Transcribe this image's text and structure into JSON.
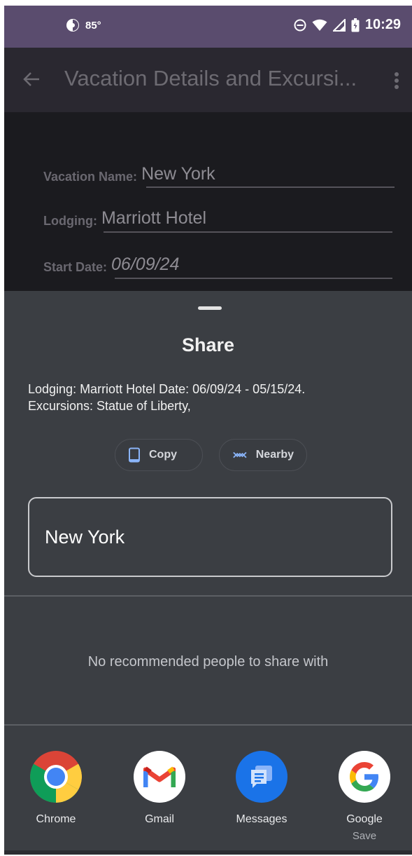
{
  "status_bar": {
    "temperature": "85°",
    "time": "10:29"
  },
  "app_bar": {
    "title": "Vacation Details and Excursi..."
  },
  "form": {
    "vacation_name_label": "Vacation Name:",
    "vacation_name_value": "New York",
    "lodging_label": "Lodging:",
    "lodging_value": "Marriott Hotel",
    "start_date_label": "Start Date:",
    "start_date_value": "06/09/24"
  },
  "share_sheet": {
    "title": "Share",
    "text_line1": "Lodging: Marriott Hotel Date: 06/09/24 - 05/15/24.",
    "text_line2": "Excursions: Statue of Liberty,",
    "copy_label": "Copy",
    "nearby_label": "Nearby",
    "share_title": "New York",
    "no_people_text": "No recommended people to share with",
    "apps": [
      {
        "label": "Chrome",
        "icon": "chrome-icon"
      },
      {
        "label": "Gmail",
        "icon": "gmail-icon"
      },
      {
        "label": "Messages",
        "icon": "messages-icon"
      },
      {
        "label": "Google",
        "sublabel": "Save",
        "icon": "google-icon"
      }
    ]
  },
  "colors": {
    "status_bar": "#5a4c6e",
    "sheet_background": "#3b3e43",
    "chip_icon_blue": "#8ab4f8"
  }
}
